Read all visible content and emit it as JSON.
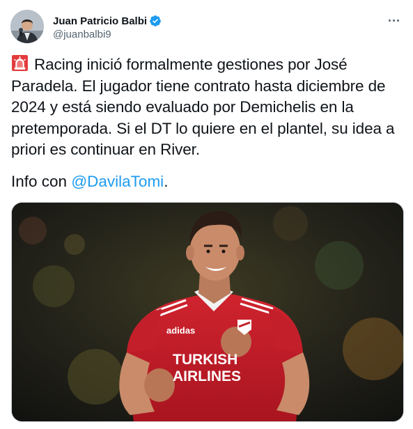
{
  "author": {
    "display_name": "Juan Patricio Balbi",
    "handle": "@juanbalbi9",
    "verified": true,
    "avatar_icon": "profile-photo"
  },
  "menu": {
    "icon": "more-horizontal-icon"
  },
  "tweet": {
    "emoji_icon": "police-siren-icon",
    "text": "Racing inició formalmente gestiones por José Paradela. El jugador tiene contrato hasta diciembre de 2024 y está siendo evaluado por Demichelis en la pretemporada. Si el DT lo quiere en el plantel, su idea a priori es continuar en River.",
    "info_prefix": "Info con ",
    "mention": "@DavilaTomi",
    "info_suffix": "."
  },
  "media": {
    "jersey_sponsor_line1": "TURKISH",
    "jersey_sponsor_line2": "AIRLINES",
    "brand_text": "adidas",
    "jersey_color": "#c21f2a",
    "accent_color": "#1d9bf0"
  }
}
